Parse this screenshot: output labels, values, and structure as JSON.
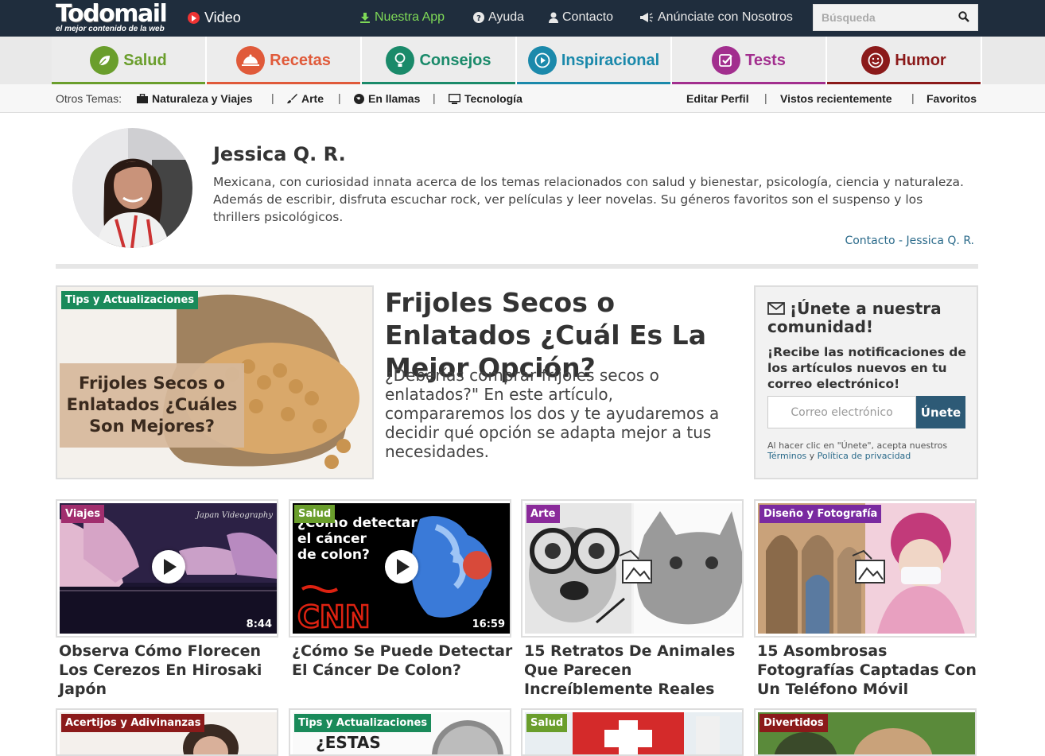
{
  "header": {
    "logo": {
      "main": "Todo",
      "main_b": "mail",
      "tagline": "el mejor contenido de la web"
    },
    "video_label": "Video",
    "nav": [
      {
        "label": "Nuestra App",
        "icon": "download-icon"
      },
      {
        "label": "Ayuda",
        "icon": "question-icon"
      },
      {
        "label": "Contacto",
        "icon": "user-icon"
      },
      {
        "label": "Anúnciate con Nosotros",
        "icon": "megaphone-icon"
      }
    ],
    "search_placeholder": "Búsqueda"
  },
  "categories": [
    {
      "label": "Salud",
      "color": "#6a9e2c",
      "icon": "leaf-icon"
    },
    {
      "label": "Recetas",
      "color": "#e05a3a",
      "icon": "dish-icon"
    },
    {
      "label": "Consejos",
      "color": "#1a8a6a",
      "icon": "bulb-icon"
    },
    {
      "label": "Inspiracional",
      "color": "#1b89ab",
      "icon": "play-icon"
    },
    {
      "label": "Tests",
      "color": "#a22e8e",
      "icon": "check-icon"
    },
    {
      "label": "Humor",
      "color": "#8b1a1a",
      "icon": "smile-icon"
    }
  ],
  "subnav": {
    "label": "Otros Temas:",
    "topics": [
      "Naturaleza y Viajes",
      "Arte",
      "En llamas",
      "Tecnología"
    ],
    "user_links": [
      "Editar Perfil",
      "Vistos recientemente",
      "Favoritos"
    ]
  },
  "profile": {
    "name": "Jessica Q. R.",
    "bio": "Mexicana, con curiosidad innata acerca de los temas relacionados con salud y bienestar, psicología, ciencia y naturaleza. Además de escribir, disfruta escuchar rock, ver películas y leer novelas. Su géneros favoritos son el suspenso y los thrillers psicológicos.",
    "contact": "Contacto - Jessica Q. R."
  },
  "featured": {
    "badge": "Tips y Actualizaciones",
    "title": "Frijoles Secos o Enlatados ¿Cuál Es La Mejor Opción?",
    "description": "¿Deberías comprar frijoles secos o enlatados?\" En este artículo, compararemos los dos y te ayudaremos a decidir qué opción se adapta mejor a tus necesidades.",
    "image_text_1": "Frijoles Secos o",
    "image_text_2": "Enlatados ¿Cuáles",
    "image_text_3": "Son Mejores?"
  },
  "subscribe": {
    "title": "¡Únete a nuestra comunidad!",
    "text": "¡Recibe las notificaciones de los artículos nuevos en tu correo electrónico!",
    "placeholder": "Correo electrónico",
    "button": "Únete",
    "legal_pre": "Al hacer clic en \"Únete\", acepta nuestros",
    "terms": "Términos",
    "and": "y",
    "privacy": "Política de privacidad"
  },
  "cards": [
    {
      "badge": "Viajes",
      "badge_color": "#a12e6e",
      "title": "Observa Cómo Florecen Los Cerezos En Hirosaki Japón",
      "duration": "8:44",
      "watermark": "Japan Videography"
    },
    {
      "badge": "Salud",
      "badge_color": "#6a9e2c",
      "title": "¿Cómo Se Puede Detectar El Cáncer De Colon?",
      "duration": "16:59",
      "overlay_text": "¿Cómo detectar el cáncer de colon?",
      "logo_text": "CNN"
    },
    {
      "badge": "Arte",
      "badge_color": "#8a2a9a",
      "title": "15 Retratos De Animales Que Parecen Increíblemente Reales"
    },
    {
      "badge": "Diseño y Fotografía",
      "badge_color": "#7a2aa0",
      "title": "15 Asombrosas Fotografías Captadas Con Un Teléfono Móvil"
    }
  ],
  "cards_row2": [
    {
      "badge": "Acertijos y Adivinanzas",
      "badge_color": "#8b1a1a"
    },
    {
      "badge": "Tips y Actualizaciones",
      "badge_color": "#1a8a5a",
      "overlay_text": "¿ESTAS"
    },
    {
      "badge": "Salud",
      "badge_color": "#6a9e2c"
    },
    {
      "badge": "Divertidos",
      "badge_color": "#8b1a1a"
    }
  ]
}
